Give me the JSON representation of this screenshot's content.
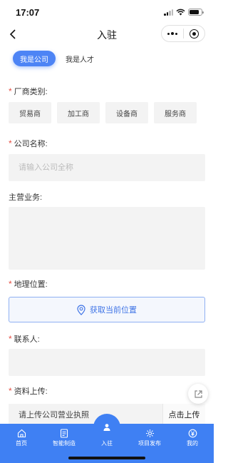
{
  "status_bar": {
    "time": "17:07"
  },
  "nav": {
    "title": "入驻"
  },
  "tabs": [
    {
      "label": "我是公司",
      "active": true
    },
    {
      "label": "我是人才",
      "active": false
    }
  ],
  "form": {
    "category": {
      "label": "厂商类别:",
      "required": true,
      "options": [
        "贸易商",
        "加工商",
        "设备商",
        "服务商"
      ]
    },
    "company_name": {
      "label": "公司名称:",
      "required": true,
      "placeholder": "请输入公司全称",
      "value": ""
    },
    "main_business": {
      "label": "主营业务:",
      "required": false,
      "value": ""
    },
    "location": {
      "label": "地理位置:",
      "required": true,
      "button_label": "获取当前位置",
      "icon": "location-pin-icon"
    },
    "contact": {
      "label": "联系人:",
      "required": true,
      "value": ""
    },
    "upload": {
      "label": "资料上传:",
      "required": true,
      "hint": "请上传公司营业执照",
      "button_label": "点击上传"
    }
  },
  "tabbar": [
    {
      "label": "首页",
      "icon": "home-icon"
    },
    {
      "label": "智能制造",
      "icon": "document-icon"
    },
    {
      "label": "入驻",
      "icon": "user-icon"
    },
    {
      "label": "项目发布",
      "icon": "gear-icon"
    },
    {
      "label": "我的",
      "icon": "yen-icon"
    }
  ],
  "colors": {
    "accent": "#4d84f5",
    "tabbar": "#3f80f3",
    "required": "#e54d42"
  }
}
